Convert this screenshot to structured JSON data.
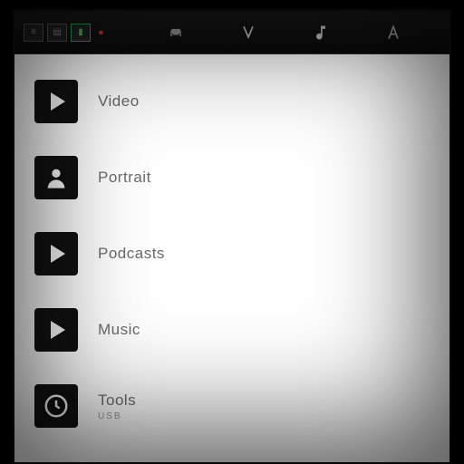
{
  "status": {
    "indicator1": "≡",
    "indicator2": "▤",
    "indicator3": "▮",
    "warning": "●"
  },
  "topTabs": [
    {
      "id": "car",
      "label": ""
    },
    {
      "id": "v",
      "label": ""
    },
    {
      "id": "note",
      "label": ""
    },
    {
      "id": "a",
      "label": ""
    },
    {
      "id": "s",
      "label": ""
    }
  ],
  "menu": [
    {
      "icon": "play",
      "label": "Video",
      "sublabel": ""
    },
    {
      "icon": "person",
      "label": "Portrait",
      "sublabel": ""
    },
    {
      "icon": "play",
      "label": "Podcasts",
      "sublabel": ""
    },
    {
      "icon": "play",
      "label": "Music",
      "sublabel": ""
    },
    {
      "icon": "clock",
      "label": "Tools",
      "sublabel": "USB"
    }
  ]
}
